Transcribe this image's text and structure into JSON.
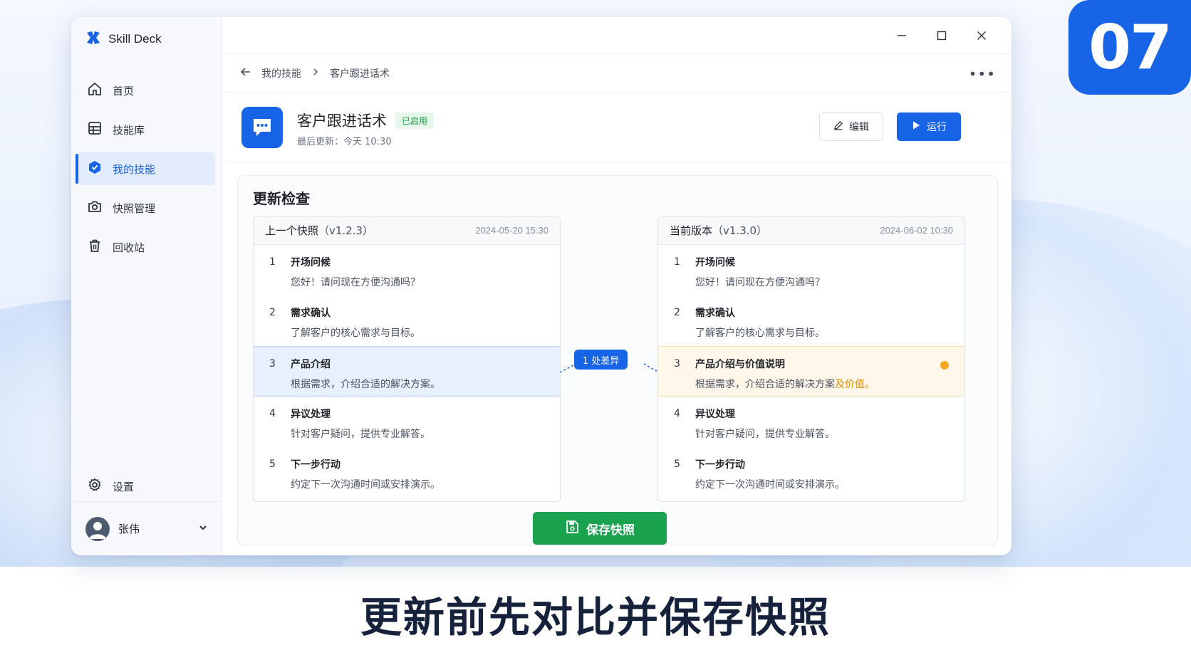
{
  "slide": {
    "number": "07",
    "caption": "更新前先对比并保存快照"
  },
  "app": {
    "name": "Skill Deck"
  },
  "sidebar": {
    "items": [
      {
        "label": "首页",
        "icon": "home-icon"
      },
      {
        "label": "技能库",
        "icon": "library-icon"
      },
      {
        "label": "我的技能",
        "icon": "my-skill-icon",
        "active": true
      },
      {
        "label": "快照管理",
        "icon": "camera-icon"
      },
      {
        "label": "回收站",
        "icon": "trash-icon"
      }
    ],
    "settings_label": "设置",
    "user_name": "张伟"
  },
  "breadcrumb": {
    "parent": "我的技能",
    "current": "客户跟进话术"
  },
  "skill": {
    "title": "客户跟进话术",
    "status": "已启用",
    "updated": "最后更新：今天 10:30",
    "edit_label": "编辑",
    "run_label": "运行"
  },
  "check": {
    "title": "更新检查",
    "diff_label": "1 处差异",
    "save_label": "保存快照",
    "left": {
      "name": "上一个快照",
      "version": "（v1.2.3）",
      "date": "2024-05-20 15:30",
      "steps": [
        {
          "num": "1",
          "title": "开场问候",
          "desc": "您好！请问现在方便沟通吗？"
        },
        {
          "num": "2",
          "title": "需求确认",
          "desc": "了解客户的核心需求与目标。"
        },
        {
          "num": "3",
          "title": "产品介绍",
          "desc": "根据需求，介绍合适的解决方案。"
        },
        {
          "num": "4",
          "title": "异议处理",
          "desc": "针对客户疑问，提供专业解答。"
        },
        {
          "num": "5",
          "title": "下一步行动",
          "desc": "约定下一次沟通时间或安排演示。"
        }
      ]
    },
    "right": {
      "name": "当前版本",
      "version": "（v1.3.0）",
      "date": "2024-06-02 10:30",
      "steps": [
        {
          "num": "1",
          "title": "开场问候",
          "desc": "您好！请问现在方便沟通吗？"
        },
        {
          "num": "2",
          "title": "需求确认",
          "desc": "了解客户的核心需求与目标。"
        },
        {
          "num": "3",
          "title": "产品介绍与价值说明",
          "desc": "根据需求，介绍合适的解决方案",
          "desc_added": "及价值。"
        },
        {
          "num": "4",
          "title": "异议处理",
          "desc": "针对客户疑问，提供专业解答。"
        },
        {
          "num": "5",
          "title": "下一步行动",
          "desc": "约定下一次沟通时间或安排演示。"
        }
      ]
    }
  },
  "colors": {
    "accent": "#1764e6",
    "success": "#1ba24e",
    "warning": "#f5a623"
  }
}
